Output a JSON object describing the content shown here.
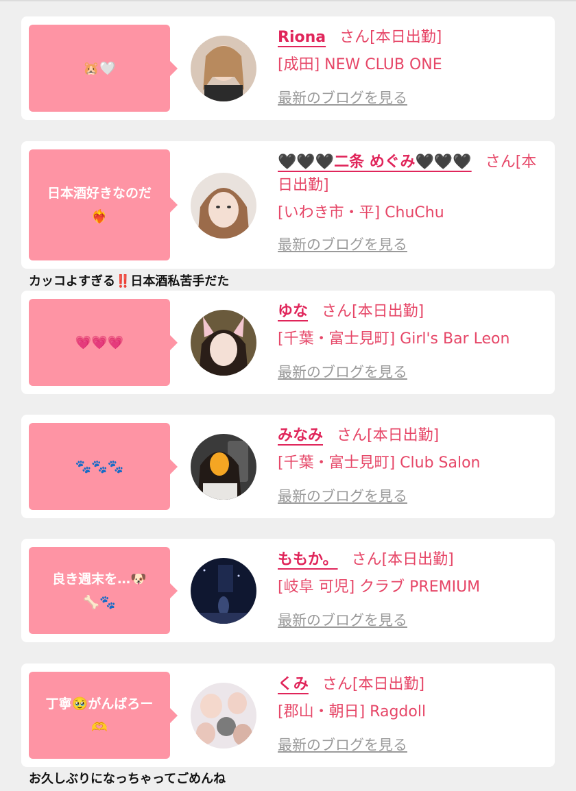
{
  "cards": [
    {
      "bubble": "🐹🤍",
      "name": "Riona",
      "suffix": "さん[本日出勤]",
      "shop": "[成田] NEW CLUB ONE",
      "blog_link": "最新のブログを見る"
    },
    {
      "bubble": "日本酒好きなのだ\n❤️‍🔥",
      "name": "🖤🖤🖤二条 めぐみ🖤🖤🖤",
      "suffix": "さん[本日出勤]",
      "shop": "[いわき市・平] ChuChu",
      "blog_link": "最新のブログを見る"
    },
    {
      "bubble": "💗💗💗",
      "name": "ゆな",
      "suffix": "さん[本日出勤]",
      "shop": "[千葉・富士見町] Girl's Bar Leon",
      "blog_link": "最新のブログを見る"
    },
    {
      "bubble": "🐾🐾🐾",
      "name": "みなみ",
      "suffix": "さん[本日出勤]",
      "shop": "[千葉・富士見町] Club Salon",
      "blog_link": "最新のブログを見る"
    },
    {
      "bubble": "良き週末を…🐶\n🦴🐾",
      "name": "ももか。",
      "suffix": "さん[本日出勤]",
      "shop": "[岐阜 可児] クラブ PREMIUM",
      "blog_link": "最新のブログを見る"
    },
    {
      "bubble": "丁寧🥹がんばろー\n🫶",
      "name": "くみ",
      "suffix": "さん[本日出勤]",
      "shop": "[郡山・朝日] Ragdoll",
      "blog_link": "最新のブログを見る"
    }
  ],
  "captions": {
    "caption1_a": "カッコよすぎる",
    "caption1_bang": "‼️",
    "caption1_b": "日本酒私苦手だた",
    "caption2": "お久しぶりになっちゃってごめんね"
  }
}
